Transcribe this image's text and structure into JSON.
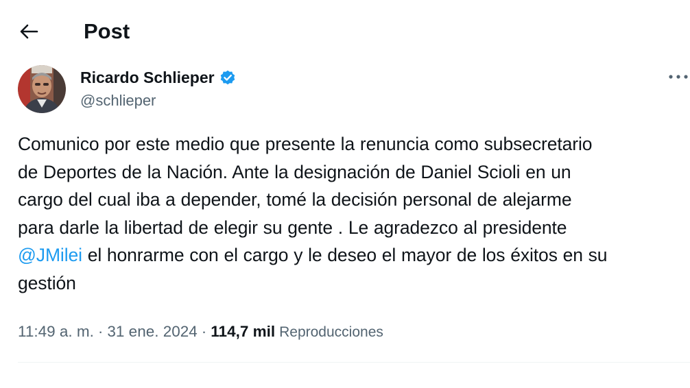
{
  "header": {
    "title": "Post",
    "back_icon": "arrow-left-icon"
  },
  "author": {
    "name": "Ricardo Schlieper",
    "handle": "@schlieper",
    "verified_icon": "verified-badge-icon",
    "verified_color": "#1d9bf0",
    "more_icon": "more-horizontal-icon"
  },
  "tweet": {
    "lines": [
      "Comunico por este medio que presente la renuncia como subsecretario",
      "de Deportes de la Nación. Ante la designación de Daniel Scioli en un",
      "cargo del cual iba a depender, tomé la decisión personal de alejarme",
      "para darle la libertad de elegir su gente . Le agradezco al presidente"
    ],
    "mention": "@JMilei",
    "line5_rest": " el honrarme con el cargo y le deseo el mayor de los éxitos en su",
    "line6": "gestión",
    "mention_color": "#1d9bf0"
  },
  "meta": {
    "time": "11:49 a. m.",
    "separator": "·",
    "date": "31 ene. 2024",
    "views_count": "114,7 mil",
    "views_label": "Reproducciones"
  }
}
